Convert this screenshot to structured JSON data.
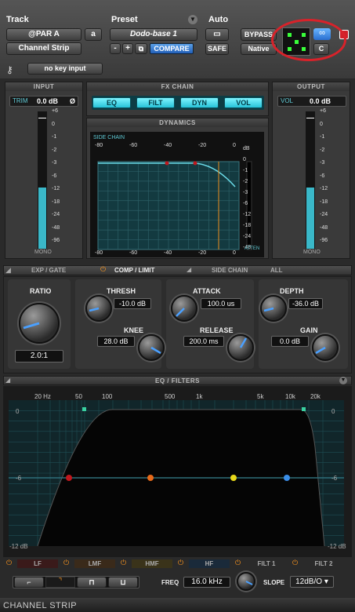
{
  "header": {
    "track_label": "Track",
    "preset_label": "Preset",
    "auto_label": "Auto",
    "track_name": "@PAR A",
    "track_slot": "a",
    "track_type": "Channel Strip",
    "preset_name": "Dodo-base 1",
    "compare": "COMPARE",
    "bypass": "BYPASS",
    "safe": "SAFE",
    "native": "Native",
    "group": "C",
    "key_input": "no key input",
    "minus": "-",
    "plus": "+"
  },
  "input": {
    "title": "INPUT",
    "trim_label": "TRIM",
    "trim_value": "0.0 dB",
    "phase": "Ø",
    "scale": [
      "+6",
      "0",
      "-1",
      "-2",
      "-3",
      "-6",
      "-12",
      "-18",
      "-24",
      "-48",
      "-96"
    ],
    "mono": "MONO",
    "level": 0.45
  },
  "output": {
    "title": "OUTPUT",
    "vol_label": "VOL",
    "vol_value": "0.0 dB",
    "scale": [
      "+6",
      "0",
      "-1",
      "-2",
      "-3",
      "-6",
      "-12",
      "-18",
      "-24",
      "-48",
      "-96"
    ],
    "mono": "MONO",
    "level": 0.45
  },
  "fxchain": {
    "title": "FX CHAIN",
    "buttons": [
      "EQ",
      "FILT",
      "DYN",
      "VOL"
    ]
  },
  "dynamics": {
    "title": "DYNAMICS",
    "side_chain": "SIDE CHAIN",
    "top_scale": [
      "-80",
      "-60",
      "-40",
      "-20",
      "0"
    ],
    "bottom_scale": [
      "-80",
      "-60",
      "-40",
      "-20",
      "0"
    ],
    "right_scale": [
      "dB",
      "0",
      "-1",
      "-2",
      "-3",
      "-6",
      "-12",
      "-18",
      "-24",
      "-48"
    ],
    "atten": "ATTEN"
  },
  "tabs": {
    "exp": "EXP / GATE",
    "comp": "COMP / LIMIT",
    "side": "SIDE CHAIN",
    "all": "ALL"
  },
  "comp": {
    "ratio_label": "RATIO",
    "ratio": "2.0:1",
    "thresh_label": "THRESH",
    "thresh": "-10.0 dB",
    "knee_label": "KNEE",
    "knee": "28.0 dB",
    "attack_label": "ATTACK",
    "attack": "100.0 us",
    "release_label": "RELEASE",
    "release": "200.0 ms",
    "depth_label": "DEPTH",
    "depth": "-36.0 dB",
    "gain_label": "GAIN",
    "gain": "0.0 dB"
  },
  "eq": {
    "title": "EQ / FILTERS",
    "freq_ticks": [
      "20 Hz",
      "50",
      "100",
      "500",
      "1k",
      "5k",
      "10k",
      "20k"
    ],
    "db_ticks": [
      "0",
      "-6",
      "-12 dB"
    ],
    "bands": [
      "LF",
      "LMF",
      "HMF",
      "HF",
      "FILT 1",
      "FILT 2"
    ],
    "freq_label": "FREQ",
    "freq": "16.0 kHz",
    "slope_label": "SLOPE",
    "slope": "12dB/O",
    "node_colors": [
      "#c0181e",
      "#e86a1a",
      "#e8d81a",
      "#3a8ee8"
    ]
  },
  "footer": {
    "title": "CHANNEL STRIP"
  }
}
